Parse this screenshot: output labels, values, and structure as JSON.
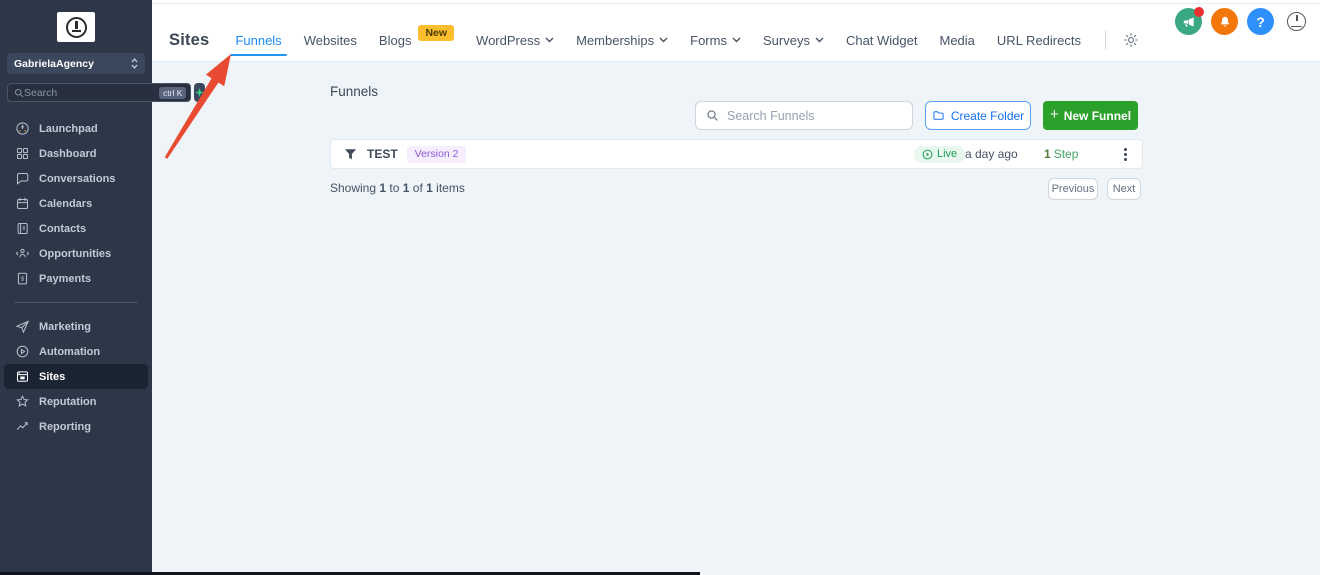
{
  "colors": {
    "sidebar_bg": "#2d3748",
    "accent_blue": "#1a8cf8",
    "new_funnel_green": "#2ba12b",
    "live_green": "#1fa159",
    "version_badge_purple": "#8a5cd6",
    "new_badge_amber": "#fcbe2d",
    "arrow_red": "#e84b31"
  },
  "sidebar": {
    "agency_name": "GabrielaAgency",
    "search": {
      "placeholder": "Search",
      "shortcut": "ctrl K"
    },
    "items_top": [
      {
        "label": "Launchpad"
      },
      {
        "label": "Dashboard"
      },
      {
        "label": "Conversations"
      },
      {
        "label": "Calendars"
      },
      {
        "label": "Contacts"
      },
      {
        "label": "Opportunities"
      },
      {
        "label": "Payments"
      }
    ],
    "items_bottom": [
      {
        "label": "Marketing"
      },
      {
        "label": "Automation"
      },
      {
        "label": "Sites",
        "active": true
      },
      {
        "label": "Reputation"
      },
      {
        "label": "Reporting"
      }
    ]
  },
  "header": {
    "section_title": "Sites",
    "tabs": [
      {
        "label": "Funnels",
        "active": true
      },
      {
        "label": "Websites"
      },
      {
        "label": "Blogs",
        "badge": "New"
      },
      {
        "label": "WordPress",
        "dropdown": true
      },
      {
        "label": "Memberships",
        "dropdown": true
      },
      {
        "label": "Forms",
        "dropdown": true
      },
      {
        "label": "Surveys",
        "dropdown": true
      },
      {
        "label": "Chat Widget"
      },
      {
        "label": "Media"
      },
      {
        "label": "URL Redirects"
      }
    ],
    "help_icon_label": "?"
  },
  "main": {
    "title": "Funnels",
    "search_placeholder": "Search Funnels",
    "create_folder_label": "Create Folder",
    "new_funnel": {
      "plus": "+",
      "label": "New Funnel"
    },
    "funnel_row": {
      "name": "TEST",
      "version_badge": "Version 2",
      "status": "Live",
      "updated": "a day ago",
      "steps_count": "1",
      "steps_label": "Step"
    },
    "pagination": {
      "p1": "Showing ",
      "n1": "1",
      "p2": " to ",
      "n2": "1",
      "p3": " of ",
      "n3": "1",
      "p4": " items",
      "previous_label": "Previous",
      "next_label": "Next"
    }
  }
}
